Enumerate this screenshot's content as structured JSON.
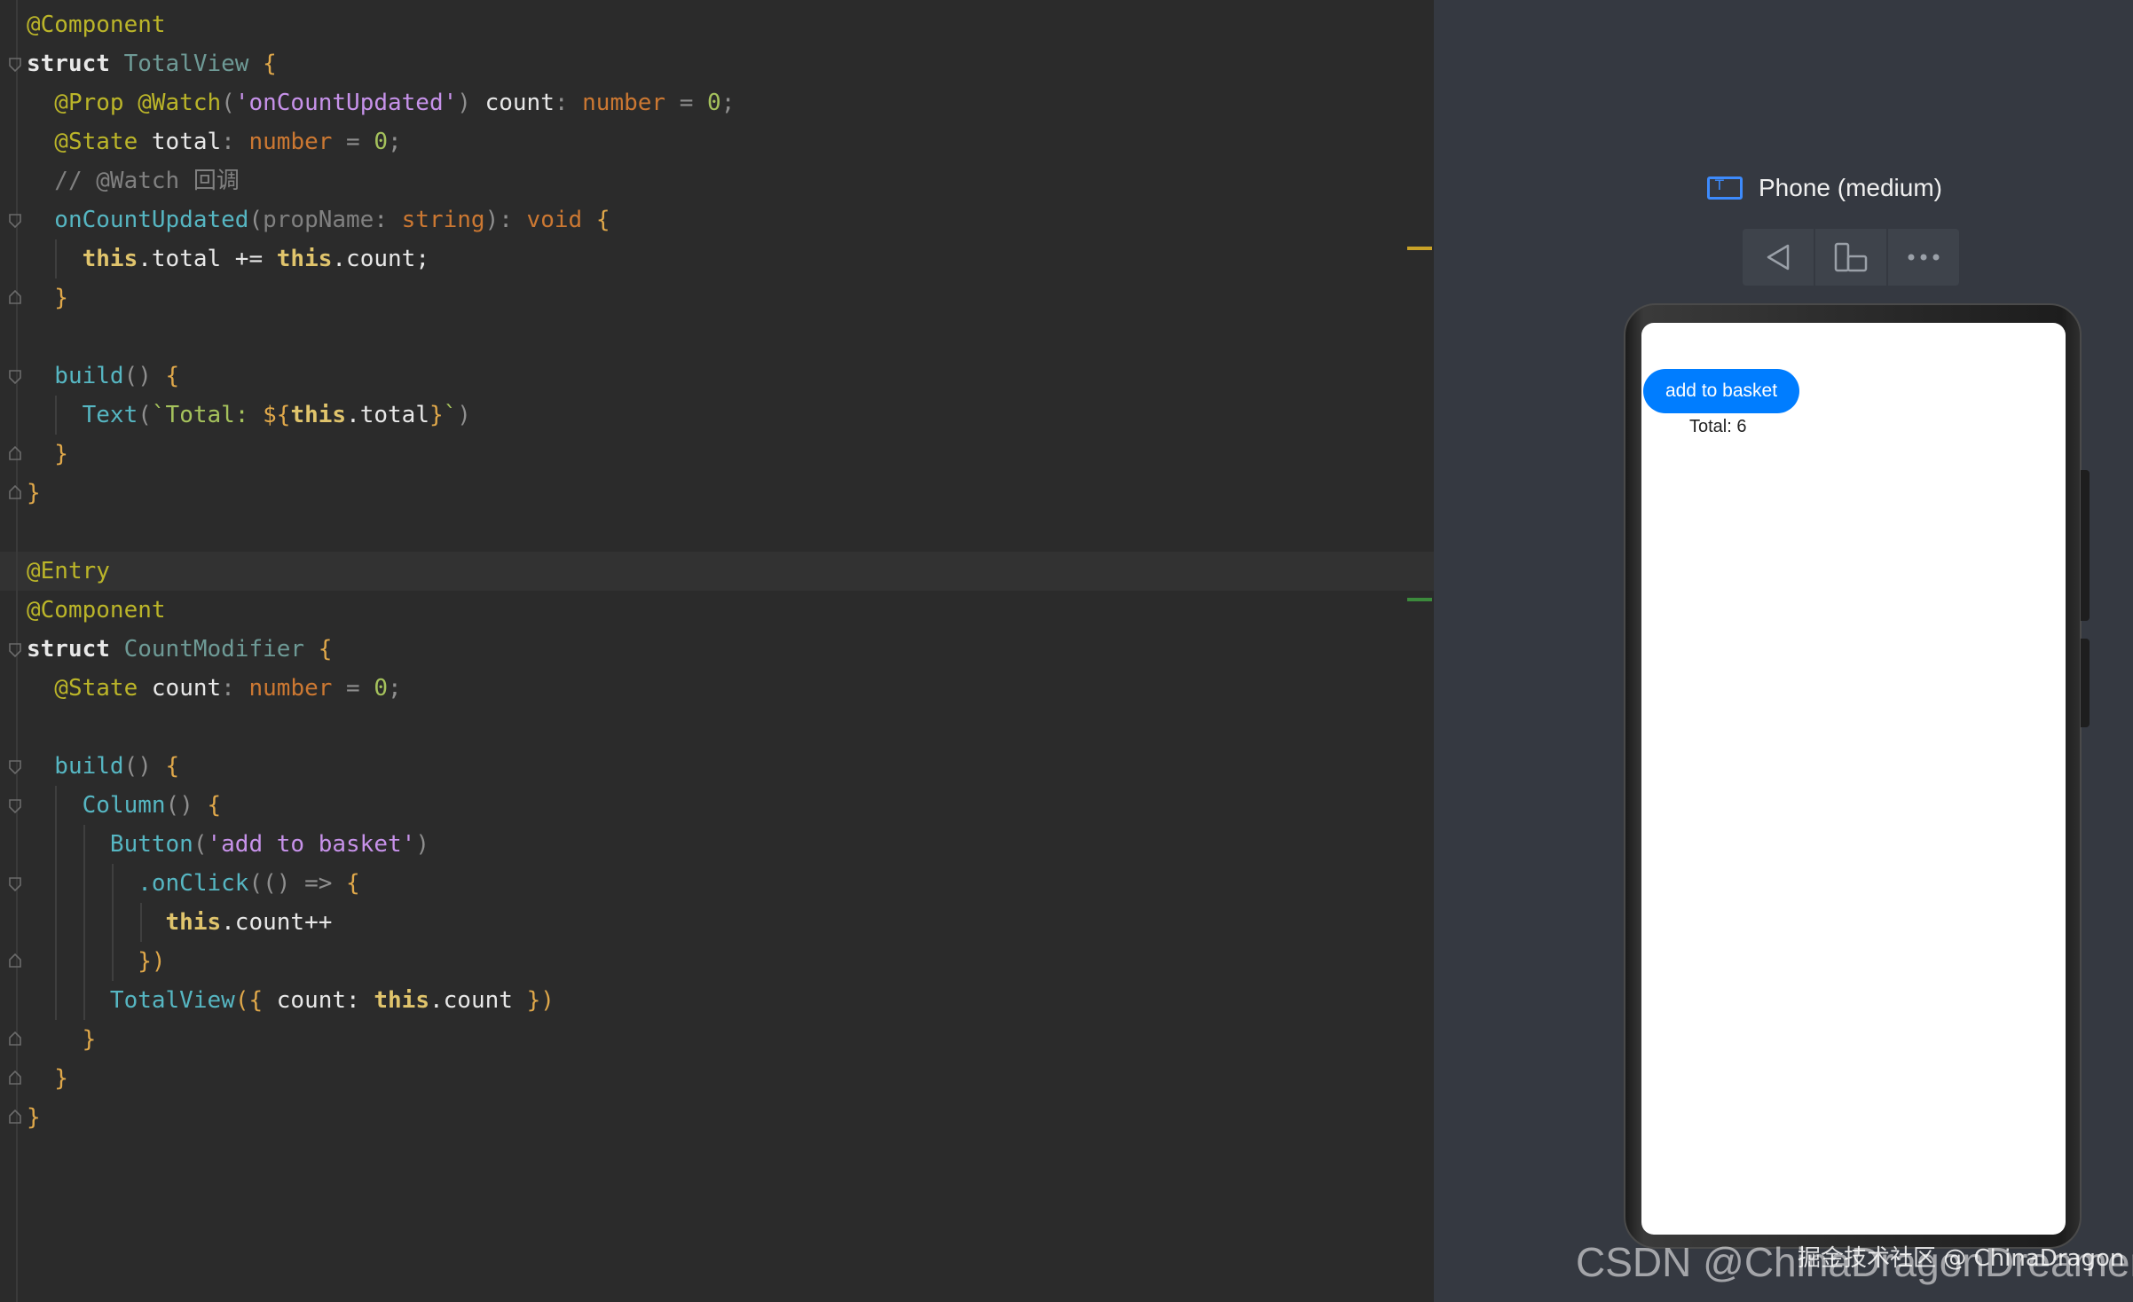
{
  "editor": {
    "lines": [
      [
        [
          "ann",
          "@Component"
        ]
      ],
      [
        [
          "kwb",
          "struct "
        ],
        [
          "ty",
          "TotalView "
        ],
        [
          "brace",
          "{"
        ]
      ],
      [
        [
          "ann",
          "  @Prop @Watch"
        ],
        [
          "par",
          "("
        ],
        [
          "str2",
          "'onCountUpdated'"
        ],
        [
          "par",
          ")"
        ],
        [
          "prop",
          " count"
        ],
        [
          "par",
          ": "
        ],
        [
          "kw",
          "number"
        ],
        [
          "par",
          " = "
        ],
        [
          "num",
          "0"
        ],
        [
          "par",
          ";"
        ]
      ],
      [
        [
          "ann",
          "  @State "
        ],
        [
          "prop",
          "total"
        ],
        [
          "par",
          ": "
        ],
        [
          "kw",
          "number"
        ],
        [
          "par",
          " = "
        ],
        [
          "num",
          "0"
        ],
        [
          "par",
          ";"
        ]
      ],
      [
        [
          "cmt",
          "  // @Watch 回调"
        ]
      ],
      [
        [
          "fn",
          "  onCountUpdated"
        ],
        [
          "par",
          "("
        ],
        [
          "cmt",
          "propName"
        ],
        [
          "par",
          ": "
        ],
        [
          "kw",
          "string"
        ],
        [
          "par",
          "): "
        ],
        [
          "kw",
          "void "
        ],
        [
          "brace",
          "{"
        ]
      ],
      [
        [
          "thisk",
          "    this"
        ],
        [
          "prop",
          ".total += "
        ],
        [
          "thisk",
          "this"
        ],
        [
          "prop",
          ".count;"
        ]
      ],
      [
        [
          "brace",
          "  }"
        ]
      ],
      [
        [
          "par",
          ""
        ]
      ],
      [
        [
          "fn",
          "  build"
        ],
        [
          "par",
          "() "
        ],
        [
          "brace",
          "{"
        ]
      ],
      [
        [
          "fn",
          "    Text"
        ],
        [
          "par",
          "("
        ],
        [
          "str",
          "`Total: "
        ],
        [
          "brace",
          "${"
        ],
        [
          "thisk",
          "this"
        ],
        [
          "prop",
          ".total"
        ],
        [
          "brace",
          "}"
        ],
        [
          "str",
          "`"
        ],
        [
          "par",
          ")"
        ]
      ],
      [
        [
          "brace",
          "  }"
        ]
      ],
      [
        [
          "brace",
          "}"
        ]
      ],
      [
        [
          "par",
          ""
        ]
      ],
      [
        [
          "ann",
          "@Entry"
        ]
      ],
      [
        [
          "ann",
          "@Component"
        ]
      ],
      [
        [
          "kwb",
          "struct "
        ],
        [
          "ty",
          "CountModifier "
        ],
        [
          "brace",
          "{"
        ]
      ],
      [
        [
          "ann",
          "  @State "
        ],
        [
          "prop",
          "count"
        ],
        [
          "par",
          ": "
        ],
        [
          "kw",
          "number"
        ],
        [
          "par",
          " = "
        ],
        [
          "num",
          "0"
        ],
        [
          "par",
          ";"
        ]
      ],
      [
        [
          "par",
          ""
        ]
      ],
      [
        [
          "fn",
          "  build"
        ],
        [
          "par",
          "() "
        ],
        [
          "brace",
          "{"
        ]
      ],
      [
        [
          "fn",
          "    Column"
        ],
        [
          "par",
          "() "
        ],
        [
          "brace",
          "{"
        ]
      ],
      [
        [
          "fn",
          "      Button"
        ],
        [
          "par",
          "("
        ],
        [
          "str2",
          "'add to basket'"
        ],
        [
          "par",
          ")"
        ]
      ],
      [
        [
          "fn",
          "        .onClick"
        ],
        [
          "par",
          "(() => "
        ],
        [
          "brace",
          "{"
        ]
      ],
      [
        [
          "thisk",
          "          this"
        ],
        [
          "prop",
          ".count++"
        ]
      ],
      [
        [
          "brace",
          "        })"
        ]
      ],
      [
        [
          "fn",
          "      TotalView"
        ],
        [
          "brace",
          "({"
        ],
        [
          "prop",
          " count: "
        ],
        [
          "thisk",
          "this"
        ],
        [
          "prop",
          ".count "
        ],
        [
          "brace",
          "})"
        ]
      ],
      [
        [
          "brace",
          "    }"
        ]
      ],
      [
        [
          "brace",
          "  }"
        ]
      ],
      [
        [
          "brace",
          "}"
        ]
      ]
    ]
  },
  "preview": {
    "device_name": "Phone (medium)",
    "toolbar": [
      "back-icon",
      "device-rotate-icon",
      "more-icon"
    ],
    "app": {
      "button_label": "add to basket",
      "total_text": "Total: 6"
    }
  },
  "watermark": {
    "csdn": "CSDN @ChinaDragonDreamer",
    "juejin": "掘金技术社区 @ ChinaDragon"
  }
}
